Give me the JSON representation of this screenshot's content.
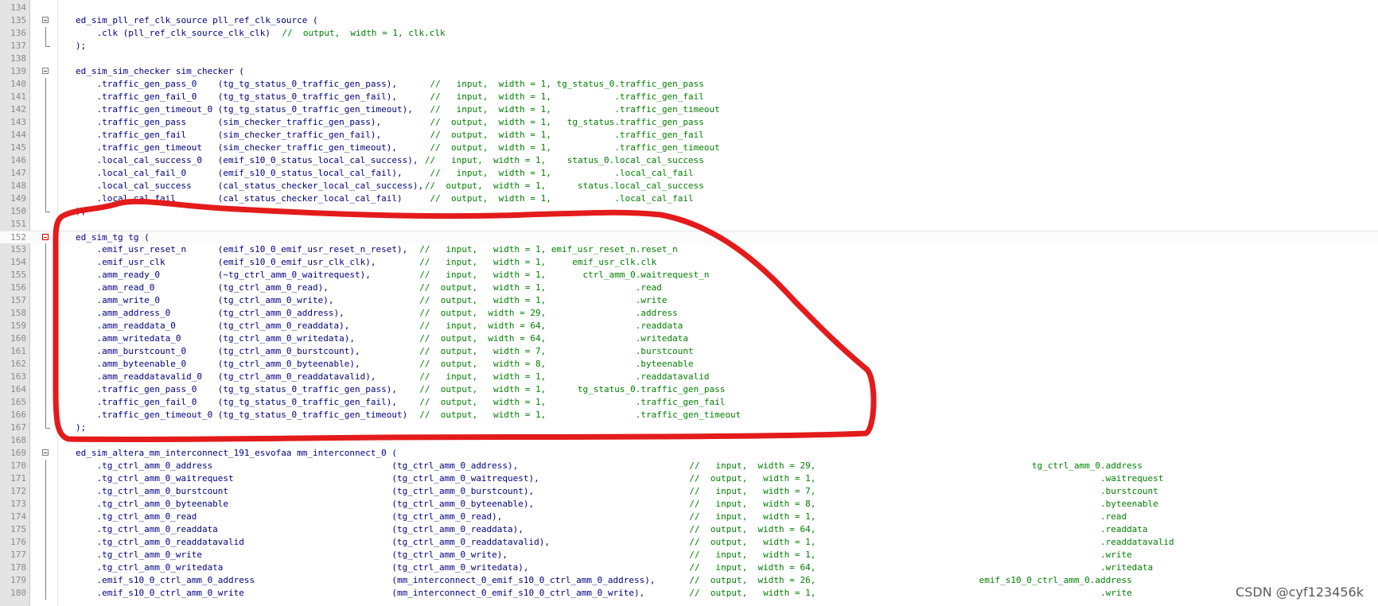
{
  "editor": {
    "lines": [
      {
        "n": "134",
        "code": "",
        "comment": "",
        "fold": "",
        "active": false
      },
      {
        "n": "135",
        "code": "ed_sim_pll_ref_clk_source pll_ref_clk_source (",
        "comment": "",
        "fold": "start",
        "active": false
      },
      {
        "n": "136",
        "code": "    .clk (pll_ref_clk_source_clk_clk)  ",
        "comment": "//  output,  width = 1, clk.clk",
        "fold": "line",
        "active": false
      },
      {
        "n": "137",
        "code": ");",
        "comment": "",
        "fold": "end",
        "active": false
      },
      {
        "n": "138",
        "code": "",
        "comment": "",
        "fold": "",
        "active": false
      },
      {
        "n": "139",
        "code": "ed_sim_sim_checker sim_checker (",
        "comment": "",
        "fold": "start",
        "active": false
      },
      {
        "n": "140",
        "code": "    .traffic_gen_pass_0    (tg_tg_status_0_traffic_gen_pass),      ",
        "comment": "//   input,  width = 1, tg_status_0.traffic_gen_pass",
        "fold": "line",
        "active": false
      },
      {
        "n": "141",
        "code": "    .traffic_gen_fail_0    (tg_tg_status_0_traffic_gen_fail),      ",
        "comment": "//   input,  width = 1,            .traffic_gen_fail",
        "fold": "line",
        "active": false
      },
      {
        "n": "142",
        "code": "    .traffic_gen_timeout_0 (tg_tg_status_0_traffic_gen_timeout),   ",
        "comment": "//   input,  width = 1,            .traffic_gen_timeout",
        "fold": "line",
        "active": false
      },
      {
        "n": "143",
        "code": "    .traffic_gen_pass      (sim_checker_traffic_gen_pass),         ",
        "comment": "//  output,  width = 1,   tg_status.traffic_gen_pass",
        "fold": "line",
        "active": false
      },
      {
        "n": "144",
        "code": "    .traffic_gen_fail      (sim_checker_traffic_gen_fail),         ",
        "comment": "//  output,  width = 1,            .traffic_gen_fail",
        "fold": "line",
        "active": false
      },
      {
        "n": "145",
        "code": "    .traffic_gen_timeout   (sim_checker_traffic_gen_timeout),      ",
        "comment": "//  output,  width = 1,            .traffic_gen_timeout",
        "fold": "line",
        "active": false
      },
      {
        "n": "146",
        "code": "    .local_cal_success_0   (emif_s10_0_status_local_cal_success), ",
        "comment": "//   input,  width = 1,    status_0.local_cal_success",
        "fold": "line",
        "active": false
      },
      {
        "n": "147",
        "code": "    .local_cal_fail_0      (emif_s10_0_status_local_cal_fail),     ",
        "comment": "//   input,  width = 1,            .local_cal_fail",
        "fold": "line",
        "active": false
      },
      {
        "n": "148",
        "code": "    .local_cal_success     (cal_status_checker_local_cal_success),",
        "comment": "//  output,  width = 1,      status.local_cal_success",
        "fold": "line",
        "active": false
      },
      {
        "n": "149",
        "code": "    .local_cal_fail        (cal_status_checker_local_cal_fail)     ",
        "comment": "//  output,  width = 1,            .local_cal_fail",
        "fold": "line",
        "active": false
      },
      {
        "n": "150",
        "code": ");",
        "comment": "",
        "fold": "end",
        "active": false
      },
      {
        "n": "151",
        "code": "",
        "comment": "",
        "fold": "",
        "active": false
      },
      {
        "n": "152",
        "code": "ed_sim_tg tg (",
        "comment": "",
        "fold": "start-red",
        "active": true
      },
      {
        "n": "153",
        "code": "    .emif_usr_reset_n      (emif_s10_0_emif_usr_reset_n_reset),  ",
        "comment": "//   input,   width = 1, emif_usr_reset_n.reset_n",
        "fold": "line",
        "active": false
      },
      {
        "n": "154",
        "code": "    .emif_usr_clk          (emif_s10_0_emif_usr_clk_clk),        ",
        "comment": "//   input,   width = 1,     emif_usr_clk.clk",
        "fold": "line",
        "active": false
      },
      {
        "n": "155",
        "code": "    .amm_ready_0           (~tg_ctrl_amm_0_waitrequest),         ",
        "comment": "//   input,   width = 1,       ctrl_amm_0.waitrequest_n",
        "fold": "line",
        "active": false
      },
      {
        "n": "156",
        "code": "    .amm_read_0            (tg_ctrl_amm_0_read),                 ",
        "comment": "//  output,   width = 1,                 .read",
        "fold": "line",
        "active": false
      },
      {
        "n": "157",
        "code": "    .amm_write_0           (tg_ctrl_amm_0_write),                ",
        "comment": "//  output,   width = 1,                 .write",
        "fold": "line",
        "active": false
      },
      {
        "n": "158",
        "code": "    .amm_address_0         (tg_ctrl_amm_0_address),              ",
        "comment": "//  output,  width = 29,                 .address",
        "fold": "line",
        "active": false
      },
      {
        "n": "159",
        "code": "    .amm_readdata_0        (tg_ctrl_amm_0_readdata),             ",
        "comment": "//   input,  width = 64,                 .readdata",
        "fold": "line",
        "active": false
      },
      {
        "n": "160",
        "code": "    .amm_writedata_0       (tg_ctrl_amm_0_writedata),            ",
        "comment": "//  output,  width = 64,                 .writedata",
        "fold": "line",
        "active": false
      },
      {
        "n": "161",
        "code": "    .amm_burstcount_0      (tg_ctrl_amm_0_burstcount),           ",
        "comment": "//  output,   width = 7,                 .burstcount",
        "fold": "line",
        "active": false
      },
      {
        "n": "162",
        "code": "    .amm_byteenable_0      (tg_ctrl_amm_0_byteenable),           ",
        "comment": "//  output,   width = 8,                 .byteenable",
        "fold": "line",
        "active": false
      },
      {
        "n": "163",
        "code": "    .amm_readdatavalid_0   (tg_ctrl_amm_0_readdatavalid),        ",
        "comment": "//   input,   width = 1,                 .readdatavalid",
        "fold": "line",
        "active": false
      },
      {
        "n": "164",
        "code": "    .traffic_gen_pass_0    (tg_tg_status_0_traffic_gen_pass),    ",
        "comment": "//  output,   width = 1,      tg_status_0.traffic_gen_pass",
        "fold": "line",
        "active": false
      },
      {
        "n": "165",
        "code": "    .traffic_gen_fail_0    (tg_tg_status_0_traffic_gen_fail),    ",
        "comment": "//  output,   width = 1,                 .traffic_gen_fail",
        "fold": "line",
        "active": false
      },
      {
        "n": "166",
        "code": "    .traffic_gen_timeout_0 (tg_tg_status_0_traffic_gen_timeout)  ",
        "comment": "//  output,   width = 1,                 .traffic_gen_timeout",
        "fold": "line",
        "active": false
      },
      {
        "n": "167",
        "code": ");",
        "comment": "",
        "fold": "end",
        "active": false
      },
      {
        "n": "168",
        "code": "",
        "comment": "",
        "fold": "",
        "active": false
      },
      {
        "n": "169",
        "code": "ed_sim_altera_mm_interconnect_191_esvofaa mm_interconnect_0 (",
        "comment": "",
        "fold": "start",
        "active": false
      },
      {
        "n": "170",
        "code": "    .tg_ctrl_amm_0_address                                  (tg_ctrl_amm_0_address),                                ",
        "comment": "//   input,  width = 29,                                         tg_ctrl_amm_0.address",
        "fold": "line",
        "active": false
      },
      {
        "n": "171",
        "code": "    .tg_ctrl_amm_0_waitrequest                              (tg_ctrl_amm_0_waitrequest),                            ",
        "comment": "//  output,   width = 1,                                                      .waitrequest",
        "fold": "line",
        "active": false
      },
      {
        "n": "172",
        "code": "    .tg_ctrl_amm_0_burstcount                               (tg_ctrl_amm_0_burstcount),                             ",
        "comment": "//   input,   width = 7,                                                      .burstcount",
        "fold": "line",
        "active": false
      },
      {
        "n": "173",
        "code": "    .tg_ctrl_amm_0_byteenable                               (tg_ctrl_amm_0_byteenable),                             ",
        "comment": "//   input,   width = 8,                                                      .byteenable",
        "fold": "line",
        "active": false
      },
      {
        "n": "174",
        "code": "    .tg_ctrl_amm_0_read                                     (tg_ctrl_amm_0_read),                                   ",
        "comment": "//   input,   width = 1,                                                      .read",
        "fold": "line",
        "active": false
      },
      {
        "n": "175",
        "code": "    .tg_ctrl_amm_0_readdata                                 (tg_ctrl_amm_0_readdata),                               ",
        "comment": "//  output,  width = 64,                                                      .readdata",
        "fold": "line",
        "active": false
      },
      {
        "n": "176",
        "code": "    .tg_ctrl_amm_0_readdatavalid                            (tg_ctrl_amm_0_readdatavalid),                          ",
        "comment": "//  output,   width = 1,                                                      .readdatavalid",
        "fold": "line",
        "active": false
      },
      {
        "n": "177",
        "code": "    .tg_ctrl_amm_0_write                                    (tg_ctrl_amm_0_write),                                  ",
        "comment": "//   input,   width = 1,                                                      .write",
        "fold": "line",
        "active": false
      },
      {
        "n": "178",
        "code": "    .tg_ctrl_amm_0_writedata                                (tg_ctrl_amm_0_writedata),                              ",
        "comment": "//   input,  width = 64,                                                      .writedata",
        "fold": "line",
        "active": false
      },
      {
        "n": "179",
        "code": "    .emif_s10_0_ctrl_amm_0_address                          (mm_interconnect_0_emif_s10_0_ctrl_amm_0_address),      ",
        "comment": "//  output,  width = 26,                               emif_s10_0_ctrl_amm_0.address",
        "fold": "line",
        "active": false
      },
      {
        "n": "180",
        "code": "    .emif_s10_0_ctrl_amm_0_write                            (mm_interconnect_0_emif_s10_0_ctrl_amm_0_write),        ",
        "comment": "//  output,   width = 1,                                                      .write",
        "fold": "line",
        "active": false
      }
    ]
  },
  "colors": {
    "code": "#000080",
    "comment": "#008000",
    "line_number": "#8a8a8a",
    "annotation": "#e41b1b"
  },
  "watermark": "CSDN @cyf123456k"
}
